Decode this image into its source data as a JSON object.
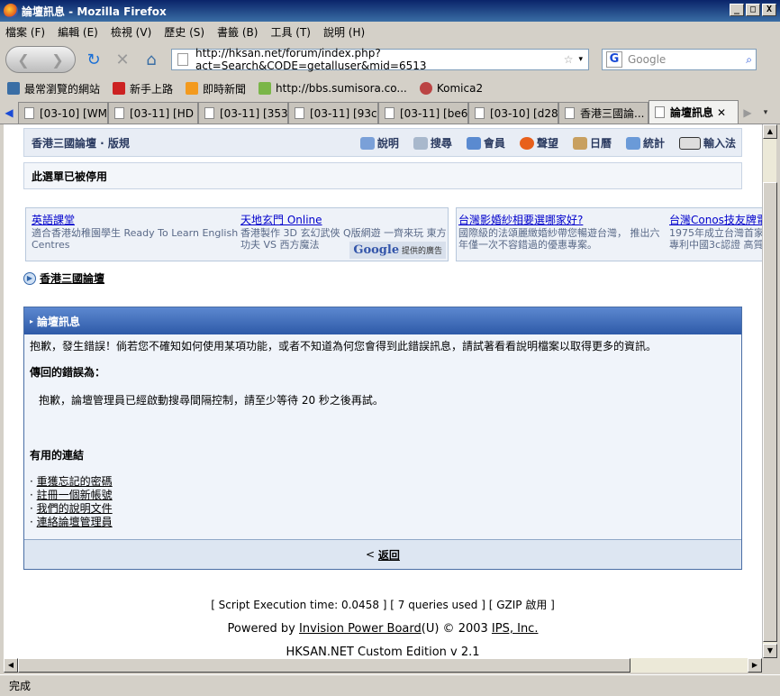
{
  "window": {
    "title": "論壇訊息 - Mozilla Firefox",
    "minimize": "_",
    "maximize": "□",
    "close": "X"
  },
  "menu": [
    "檔案 (F)",
    "編輯 (E)",
    "檢視 (V)",
    "歷史 (S)",
    "書籤 (B)",
    "工具 (T)",
    "說明 (H)"
  ],
  "nav": {
    "url": "http://hksan.net/forum/index.php?act=Search&CODE=getalluser&mid=6513",
    "search_placeholder": "Google"
  },
  "bookmarks": [
    "最常瀏覽的網站",
    "新手上路",
    "即時新聞",
    "http://bbs.sumisora.co...",
    "Komica2"
  ],
  "tabs": [
    "[03-10] [WM...",
    "[03-11] [HD ...",
    "[03-11] [353...",
    "[03-11] [93c...",
    "[03-11] [be6...",
    "[03-10] [d28...",
    "香港三國論...",
    "論壇訊息"
  ],
  "page": {
    "forum_title": "香港三國論壇 · 版規",
    "nav": [
      "說明",
      "搜尋",
      "會員",
      "聲望",
      "日曆",
      "統計",
      "輸入法"
    ],
    "menu_disabled": "此選單已被停用",
    "ads": [
      {
        "title": "英語課堂",
        "text": "適合香港幼稚園學生 Ready To Learn English Centres"
      },
      {
        "title": "天地玄門 Online",
        "text": "香港製作 3D 玄幻武俠 Q版網遊 一齊來玩 東方功夫 VS 西方魔法"
      },
      {
        "title": "台灣影婚紗相要選哪家好?",
        "text": "國際級的法頌麗緻婚紗帶您暢遊台灣， 推出六年僅一次不容錯過的優惠專案。"
      },
      {
        "title": "台灣Conos技友牌電",
        "text": "1975年成立台灣首家 專利中國3c認證 高質"
      }
    ],
    "google_badge_logo": "Google",
    "google_badge": "提供的廣告",
    "breadcrumb": "香港三國論壇",
    "board_header": "論壇訊息",
    "intro": "抱歉，發生錯誤！倘若您不確知如何使用某項功能，或者不知道為何您會得到此錯誤訊息，請試著看看說明檔案以取得更多的資訊。",
    "error_title": "傳回的錯誤為：",
    "error_msg": "抱歉，論壇管理員已經啟動搜尋間隔控制，請至少等待 20 秒之後再試。",
    "links_title": "有用的連結",
    "links": [
      "重獲忘記的密碼",
      "註冊一個新帳號",
      "我們的說明文件",
      "連絡論壇管理員"
    ],
    "back": "返回",
    "footer_stats": "[ Script Execution time: 0.0458 ]   [ 7 queries used ]   [ GZIP 啟用 ]",
    "powered_by": "Powered by",
    "ipb": "Invision Power Board",
    "ipb_suffix": "(U) © 2003",
    "ips": "IPS, Inc.",
    "edition": "HKSAN.NET Custom Edition v 2.1"
  },
  "status": "完成"
}
